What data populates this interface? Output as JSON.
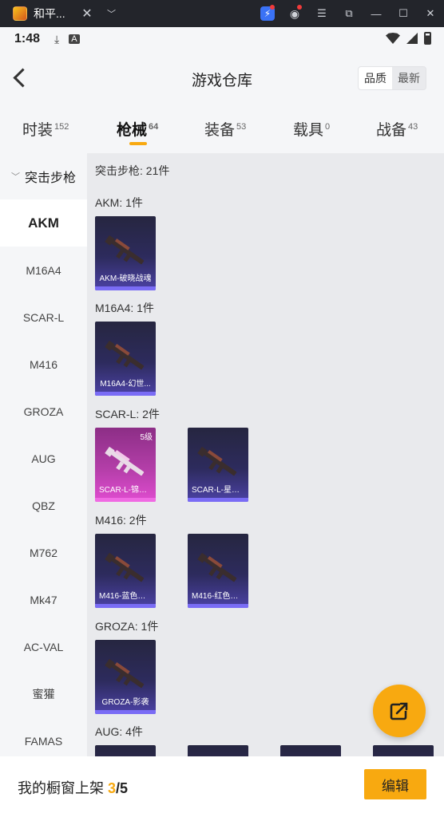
{
  "window": {
    "tab_title": "和平...",
    "close_glyph": "✕",
    "dropdown_glyph": "﹀",
    "buttons": [
      "bolt",
      "user",
      "menu",
      "screenshot",
      "minimize",
      "maximize",
      "close"
    ]
  },
  "status": {
    "time": "1:48",
    "download_glyph": "⤓",
    "a_glyph": "A"
  },
  "header": {
    "title": "游戏仓库",
    "sort_quality": "品质",
    "sort_latest": "最新"
  },
  "category_tabs": [
    {
      "label": "时装",
      "count": "152"
    },
    {
      "label": "枪械",
      "count": "64",
      "active": true
    },
    {
      "label": "装备",
      "count": "53"
    },
    {
      "label": "载具",
      "count": "0"
    },
    {
      "label": "战备",
      "count": "43"
    }
  ],
  "sidebar": {
    "header": "突击步枪",
    "items": [
      "AKM",
      "M16A4",
      "SCAR-L",
      "M416",
      "GROZA",
      "AUG",
      "QBZ",
      "M762",
      "Mk47",
      "AC-VAL",
      "蜜獾",
      "FAMAS"
    ],
    "active_index": 0
  },
  "content": {
    "summary": "突击步枪: 21件",
    "groups": [
      {
        "title": "AKM: 1件",
        "items": [
          {
            "name": "AKM-破晓战魂"
          }
        ]
      },
      {
        "title": "M16A4: 1件",
        "items": [
          {
            "name": "M16A4-幻世..."
          }
        ]
      },
      {
        "title": "SCAR-L: 2件",
        "items": [
          {
            "name": "SCAR-L-锦绣...",
            "level": "5级",
            "rarity": "pink"
          },
          {
            "name": "SCAR-L-星途..."
          }
        ]
      },
      {
        "title": "M416: 2件",
        "items": [
          {
            "name": "M416-蓝色火..."
          },
          {
            "name": "M416-红色方..."
          }
        ]
      },
      {
        "title": "GROZA: 1件",
        "items": [
          {
            "name": "GROZA-影袭"
          }
        ]
      },
      {
        "title": "AUG: 4件",
        "items": [
          {
            "name": ""
          },
          {
            "name": ""
          },
          {
            "name": ""
          },
          {
            "name": ""
          }
        ]
      }
    ]
  },
  "bottom": {
    "label": "我的橱窗上架 ",
    "current": "3",
    "separator": "/",
    "total": "5",
    "edit": "编辑"
  },
  "colors": {
    "accent": "#f8a910",
    "card_bg": "#2d2b5d",
    "card_pink": "#e04cd0"
  }
}
